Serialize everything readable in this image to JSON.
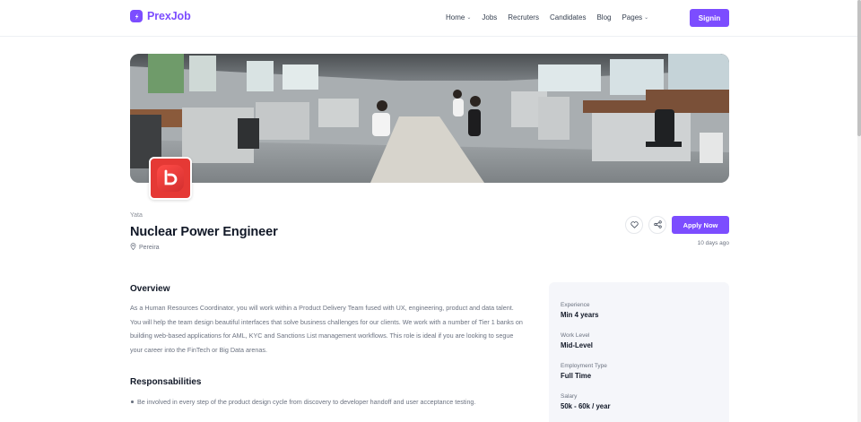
{
  "brand": {
    "name": "PrexJob",
    "color": "#7c4dff"
  },
  "nav": {
    "items": [
      {
        "label": "Home",
        "dropdown": true
      },
      {
        "label": "Jobs",
        "dropdown": false
      },
      {
        "label": "Recruters",
        "dropdown": false
      },
      {
        "label": "Candidates",
        "dropdown": false
      },
      {
        "label": "Blog",
        "dropdown": false
      },
      {
        "label": "Pages",
        "dropdown": true
      }
    ],
    "signin_label": "Signin"
  },
  "job": {
    "company": "Yata",
    "title": "Nuclear Power Engineer",
    "location": "Pereira",
    "apply_label": "Apply Now",
    "posted": "10 days ago",
    "company_logo_icon": "bebo-b-logo",
    "company_logo_color": "#e53935"
  },
  "overview": {
    "heading": "Overview",
    "text": "As a Human Resources Coordinator, you will work within a Product Delivery Team fused with UX, engineering, product and data talent. You will help the team design beautiful interfaces that solve business challenges for our clients. We work with a number of Tier 1 banks on building web-based applications for AML, KYC and Sanctions List management workflows. This role is ideal if you are looking to segue your career into the FinTech or Big Data arenas."
  },
  "responsibilities": {
    "heading": "Responsabilities",
    "items": [
      "Be involved in every step of the product design cycle from discovery to developer handoff and user acceptance testing."
    ]
  },
  "details": [
    {
      "label": "Experience",
      "value": "Min 4 years"
    },
    {
      "label": "Work Level",
      "value": "Mid-Level"
    },
    {
      "label": "Employment Type",
      "value": "Full Time"
    },
    {
      "label": "Salary",
      "value": "50k - 60k / year"
    }
  ]
}
